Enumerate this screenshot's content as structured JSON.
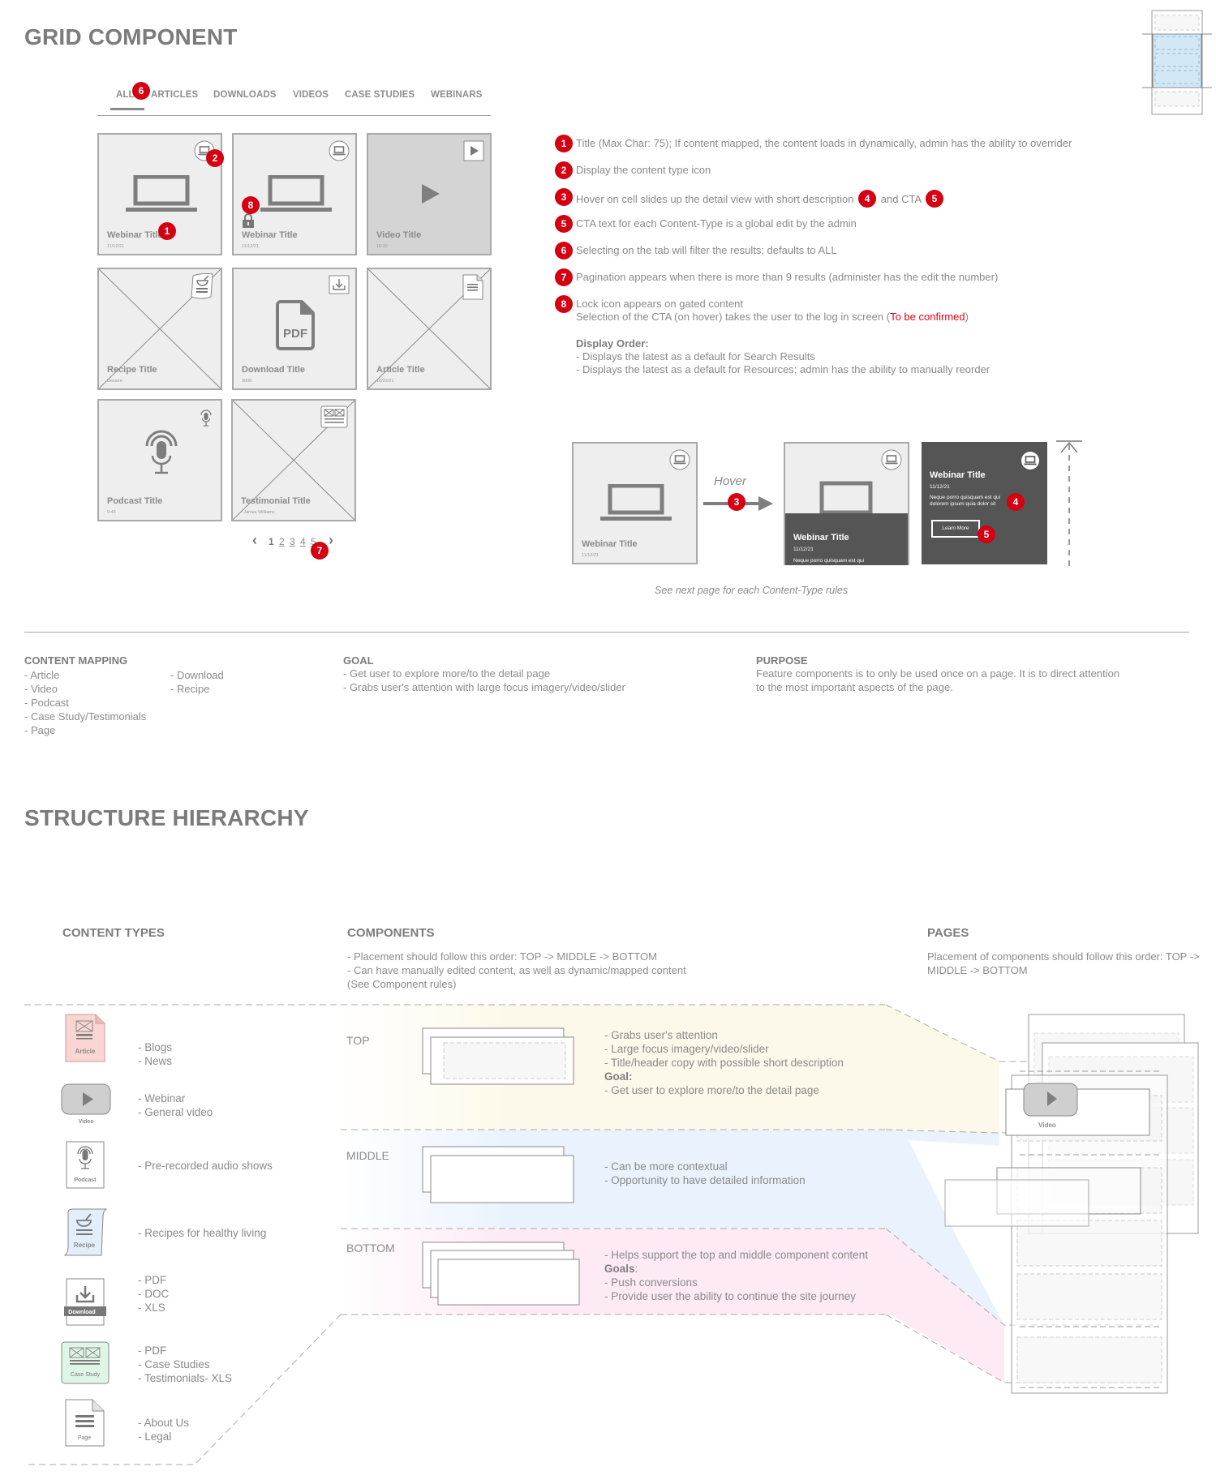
{
  "grid_component": {
    "title": "GRID COMPONENT",
    "tabs": [
      {
        "label": "ALL",
        "active": true
      },
      {
        "label": "ARTICLES"
      },
      {
        "label": "DOWNLOADS"
      },
      {
        "label": "VIDEOS"
      },
      {
        "label": "CASE STUDIES"
      },
      {
        "label": "WEBINARS"
      }
    ],
    "cards": [
      {
        "type": "webinar",
        "title": "Webinar Title",
        "meta": "11/12/21",
        "icon": "laptop-icon"
      },
      {
        "type": "webinar",
        "title": "Webinar Title",
        "meta": "11/12/21",
        "icon": "laptop-icon",
        "locked": true
      },
      {
        "type": "video",
        "title": "Video Title",
        "meta": "10:30",
        "icon": "play-icon"
      },
      {
        "type": "recipe",
        "title": "Recipe Title",
        "meta": "Dessert",
        "icon": "recipe-icon"
      },
      {
        "type": "download",
        "title": "Download Title",
        "meta": "300K",
        "icon": "download-icon",
        "file_label": "PDF"
      },
      {
        "type": "article",
        "title": "Article Title",
        "meta": "10/22/21",
        "icon": "article-icon"
      },
      {
        "type": "podcast",
        "title": "Podcast Title",
        "meta": "9:45",
        "icon": "microphone-icon"
      },
      {
        "type": "testimonial",
        "title": "Testimonial Title",
        "meta": "- James Williams",
        "icon": "case-study-icon"
      }
    ],
    "pagination": {
      "pages": [
        "1",
        "2",
        "3",
        "4",
        "5"
      ],
      "current": "1",
      "prev": "‹",
      "next": "›"
    },
    "badges": {
      "tab": "6",
      "type_icon": "2",
      "title": "1",
      "lock": "8",
      "pagination": "7",
      "hover": "3",
      "desc": "4",
      "cta": "5"
    },
    "notes": [
      {
        "num": "1",
        "text": "Title (Max Char: 75); If content mapped, the content loads in dynamically, admin has the ability to overrider"
      },
      {
        "num": "2",
        "text": "Display the content type icon"
      },
      {
        "num": "3",
        "text_a": "Hover on cell slides up the detail view with short description",
        "badge_a": "4",
        "text_b": "and CTA",
        "badge_b": "5"
      },
      {
        "num": "5",
        "text": "CTA text for each Content-Type is a global edit by the admin"
      },
      {
        "num": "6",
        "text": "Selecting on the tab will filter the results; defaults to ALL"
      },
      {
        "num": "7",
        "text": "Pagination appears when there is more than 9 results (administer has the edit the number)"
      },
      {
        "num": "8",
        "line1": "Lock icon appears on gated content",
        "line2_pre": "Selection of the CTA (on hover) takes the user to the log in screen (",
        "line2_red": "To be confirmed",
        "line2_post": ")"
      }
    ],
    "display_order": {
      "heading": "Display Order:",
      "items": [
        "- Displays the latest as a default for Search Results",
        "- Displays the latest as a default for Resources; admin has the ability to manually reorder"
      ]
    },
    "hover_demo": {
      "hover_label": "Hover",
      "card_title": "Webinar Title",
      "card_date": "11/12/21",
      "description": "Neque porro quisquam est qui dolorem ipsum quia dolor sit",
      "description_short": "Neque porro quisquam est qui",
      "cta_label": "Learn More",
      "caption": "See next page for each Content-Type rules"
    }
  },
  "info": {
    "content_mapping": {
      "heading": "CONTENT MAPPING",
      "col1": [
        "- Article",
        "- Video",
        "- Podcast",
        "- Case Study/Testimonials",
        "- Page"
      ],
      "col2": [
        "- Download",
        "- Recipe"
      ]
    },
    "goal": {
      "heading": "GOAL",
      "items": [
        "- Get user to explore more/to the detail page",
        "- Grabs user's attention with large focus imagery/video/slider"
      ]
    },
    "purpose": {
      "heading": "PURPOSE",
      "text": "Feature components is to only be used once on a page. It is to direct attention to the most important aspects of the page."
    }
  },
  "structure": {
    "title": "STRUCTURE HIERARCHY",
    "content_types_heading": "CONTENT TYPES",
    "components_heading": "COMPONENTS",
    "components_notes": [
      "- Placement should follow this order: TOP -> MIDDLE -> BOTTOM",
      "- Can have manually edited content, as well as dynamic/mapped content (See Component rules)"
    ],
    "pages_heading": "PAGES",
    "pages_note": "Placement of components should follow this order: TOP -> MIDDLE -> BOTTOM",
    "content_types": [
      {
        "label": "Article",
        "icon": "article-icon",
        "items": [
          "- Blogs",
          "- News"
        ],
        "color": "#f9d6d1"
      },
      {
        "label": "Video",
        "icon": "video-icon",
        "items": [
          "- Webinar",
          "- General video"
        ],
        "color": "#cfcfcf"
      },
      {
        "label": "Podcast",
        "icon": "podcast-icon",
        "items": [
          "- Pre-recorded audio shows"
        ],
        "color": "#ffffff"
      },
      {
        "label": "Recipe",
        "icon": "recipe-icon",
        "items": [
          "- Recipes for healthy living"
        ],
        "color": "#e3eefb"
      },
      {
        "label": "Download",
        "icon": "download-icon",
        "items": [
          "- PDF",
          "- DOC",
          "- XLS"
        ],
        "color": "#ffffff"
      },
      {
        "label": "Case Study",
        "icon": "case-study-icon",
        "items": [
          "- PDF",
          "- Case Studies",
          "- Testimonials- XLS"
        ],
        "color": "#dff5e6"
      },
      {
        "label": "Page",
        "icon": "page-icon",
        "items": [
          "- About Us",
          "- Legal"
        ],
        "color": "#ffffff"
      }
    ],
    "tiers": [
      {
        "label": "TOP",
        "lines": [
          "- Grabs user's attention",
          "- Large focus imagery/video/slider",
          "- Title/header copy with possible short description"
        ],
        "goal_heading": "Goal:",
        "goal_lines": [
          "- Get user to explore more/to the detail page"
        ],
        "color": "#fdf9ea"
      },
      {
        "label": "MIDDLE",
        "lines": [
          "- Can be more contextual",
          "- Opportunity to have detailed information"
        ],
        "color": "#eaf3fd"
      },
      {
        "label": "BOTTOM",
        "lines": [
          "- Helps support the top and middle component content"
        ],
        "goal_heading": "Goals",
        "goal_suffix": ":",
        "goal_lines": [
          "- Push conversions",
          "- Provide user the ability to continue the site journey"
        ],
        "color": "#fdeaf4"
      }
    ],
    "page_video_label": "Video"
  }
}
